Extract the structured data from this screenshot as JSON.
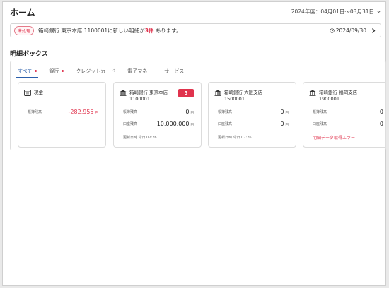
{
  "header": {
    "title": "ホーム",
    "fiscal_period": "2024年度：04月01日〜03月31日",
    "fiscal_icon": "chevron-down-icon"
  },
  "notice": {
    "badge": "未処理",
    "message_prefix": "箱崎銀行 東京本店 1100001に新しい明細が",
    "message_count": "3件",
    "message_suffix": "あります。",
    "date": "2024/09/30",
    "clock_icon": "clock-icon",
    "arrow_icon": "chevron-right-icon"
  },
  "section": {
    "title": "明細ボックス"
  },
  "tabs": [
    {
      "label": "すべて",
      "active": true,
      "dot": true
    },
    {
      "label": "銀行",
      "active": false,
      "dot": true
    },
    {
      "label": "クレジットカード",
      "active": false,
      "dot": false
    },
    {
      "label": "電子マネー",
      "active": false,
      "dot": false
    },
    {
      "label": "サービス",
      "active": false,
      "dot": false
    }
  ],
  "cards": [
    {
      "icon": "wallet-icon",
      "title": "現金",
      "rows": [
        {
          "label": "帳簿残高",
          "value": "-282,955",
          "unit": "円",
          "negative": true
        }
      ]
    },
    {
      "icon": "bank-icon",
      "title": "箱崎銀行 東京本店 1100001",
      "badge": "3",
      "rows": [
        {
          "label": "帳簿残高",
          "value": "0",
          "unit": "円",
          "negative": false
        },
        {
          "label": "口座残高",
          "value": "10,000,000",
          "unit": "円",
          "negative": false
        }
      ],
      "updated": "更新日時 今日 07:26"
    },
    {
      "icon": "bank-icon",
      "title": "箱崎銀行 大阪支店 1500001",
      "rows": [
        {
          "label": "帳簿残高",
          "value": "0",
          "unit": "円",
          "negative": false
        },
        {
          "label": "口座残高",
          "value": "0",
          "unit": "円",
          "negative": false
        }
      ],
      "updated": "更新日時 今日 07:26"
    },
    {
      "icon": "bank-icon",
      "title": "箱崎銀行 福岡支店 1900001",
      "rows": [
        {
          "label": "帳簿残高",
          "value": "0",
          "unit": "",
          "negative": false
        },
        {
          "label": "口座残高",
          "value": "0",
          "unit": "",
          "negative": false
        }
      ],
      "error": "明細データ取得エラー"
    }
  ],
  "colors": {
    "accent": "#2b5fab",
    "alert": "#e0334d"
  }
}
